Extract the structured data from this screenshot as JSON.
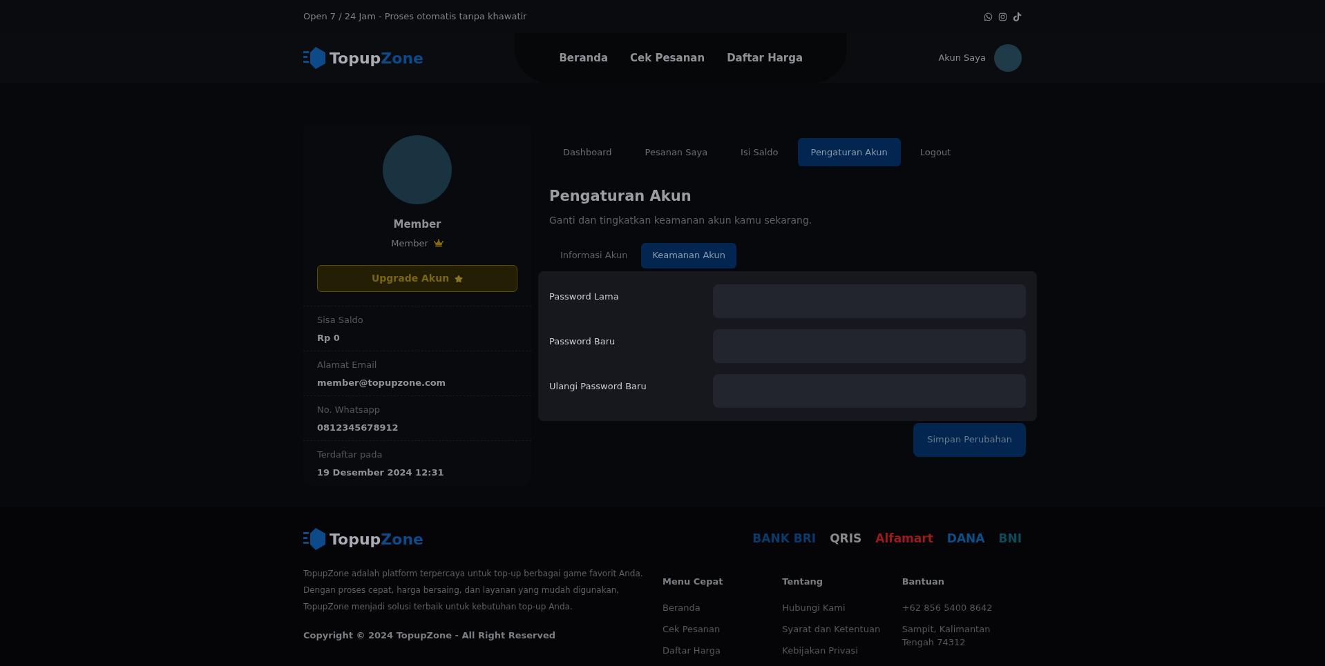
{
  "top_bar": {
    "notice": "Open 7 / 24 Jam - Proses otomatis tanpa khawatir"
  },
  "nav": {
    "brand": {
      "first": "Topup",
      "second": "Zone"
    },
    "links": [
      "Beranda",
      "Cek Pesanan",
      "Daftar Harga"
    ],
    "account_label": "Akun Saya"
  },
  "profile": {
    "name": "Member",
    "role": "Member",
    "upgrade_button": "Upgrade Akun",
    "details": [
      {
        "label": "Sisa Saldo",
        "value": "Rp 0"
      },
      {
        "label": "Alamat Email",
        "value": "member@topupzone.com"
      },
      {
        "label": "No. Whatsapp",
        "value": "0812345678912"
      },
      {
        "label": "Terdaftar pada",
        "value": "19 Desember 2024 12:31"
      }
    ]
  },
  "tabs": [
    {
      "label": "Dashboard",
      "selected": false
    },
    {
      "label": "Pesanan Saya",
      "selected": false
    },
    {
      "label": "Isi Saldo",
      "selected": false
    },
    {
      "label": "Pengaturan Akun",
      "selected": true
    },
    {
      "label": "Logout",
      "selected": false
    }
  ],
  "page": {
    "title": "Pengaturan Akun",
    "description": "Ganti dan tingkatkan keamanan akun kamu sekarang."
  },
  "subtabs": [
    {
      "label": "Informasi Akun",
      "selected": false
    },
    {
      "label": "Keamanan Akun",
      "selected": true
    }
  ],
  "form": {
    "fields": [
      {
        "label": "Password Lama"
      },
      {
        "label": "Password Baru"
      },
      {
        "label": "Ulangi Password Baru"
      }
    ],
    "submit": "Simpan Perubahan"
  },
  "footer": {
    "brand": {
      "first": "Topup",
      "second": "Zone"
    },
    "payment_logos": [
      {
        "text": "BANK BRI",
        "color": "#0a3a6a"
      },
      {
        "text": "QRIS",
        "color": "#8a8a8a"
      },
      {
        "text": "Alfamart",
        "color": "#9a1c1c"
      },
      {
        "text": "DANA",
        "color": "#0b4f8a"
      },
      {
        "text": "BNI",
        "color": "#0b4b5a"
      }
    ],
    "about": "TopupZone adalah platform terpercaya untuk top-up berbagai game favorit Anda. Dengan proses cepat, harga bersaing, dan layanan yang mudah digunakan, TopupZone menjadi solusi terbaik untuk kebutuhan top-up Anda.",
    "copyright": "Copyright © 2024 TopupZone - All Right Reserved",
    "columns": [
      {
        "heading": "Menu Cepat",
        "items": [
          "Beranda",
          "Cek Pesanan",
          "Daftar Harga"
        ]
      },
      {
        "heading": "Tentang",
        "items": [
          "Hubungi Kami",
          "Syarat dan Ketentuan",
          "Kebijakan Privasi"
        ]
      },
      {
        "heading": "Bantuan",
        "items": [
          "+62 856 5400 8642",
          "Sampit, Kalimantan Tengah 74312"
        ]
      }
    ]
  }
}
